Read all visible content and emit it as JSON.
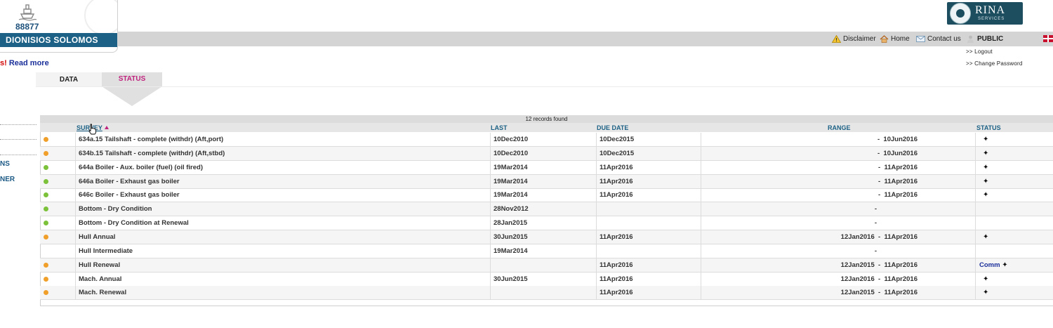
{
  "ship": {
    "number": "88877",
    "name": "DIONISIOS SOLOMOS"
  },
  "brand": {
    "name": "RINA",
    "sub": "SERVICES"
  },
  "nav": {
    "disclaimer": "Disclaimer",
    "home": "Home",
    "contact": "Contact us",
    "user": "PUBLIC"
  },
  "account": {
    "logout": ">> Logout",
    "change_password": ">> Change Password"
  },
  "alert": {
    "prefix": "s!",
    "link": "Read more"
  },
  "tabs": [
    {
      "label": "DATA"
    },
    {
      "label": "STATUS"
    }
  ],
  "sidebar": {
    "item1": "NS",
    "item2": "NER"
  },
  "table": {
    "records": "12 records found",
    "headers": {
      "survey": "SURVEY",
      "last": "LAST",
      "due": "DUE DATE",
      "range": "RANGE",
      "status": "STATUS"
    },
    "rows": [
      {
        "dot": "orange",
        "survey": "634a.15 Tailshaft - complete (withdr) (Aft,port)",
        "last": "10Dec2010",
        "due": "10Dec2015",
        "range": " -  10Jun2016",
        "status": "✦",
        "comm": ""
      },
      {
        "dot": "orange",
        "survey": "634b.15 Tailshaft - complete (withdr) (Aft,stbd)",
        "last": "10Dec2010",
        "due": "10Dec2015",
        "range": " -  10Jun2016",
        "status": "✦",
        "comm": ""
      },
      {
        "dot": "green",
        "survey": "644a Boiler - Aux. boiler (fuel) (oil fired)",
        "last": "19Mar2014",
        "due": "11Apr2016",
        "range": " -  11Apr2016",
        "status": "✦",
        "comm": ""
      },
      {
        "dot": "green",
        "survey": "646a Boiler - Exhaust gas boiler",
        "last": "19Mar2014",
        "due": "11Apr2016",
        "range": " -  11Apr2016",
        "status": "✦",
        "comm": ""
      },
      {
        "dot": "green",
        "survey": "646c Boiler - Exhaust gas boiler",
        "last": "19Mar2014",
        "due": "11Apr2016",
        "range": " -  11Apr2016",
        "status": "✦",
        "comm": ""
      },
      {
        "dot": "green",
        "survey": "Bottom - Dry Condition",
        "last": "28Nov2012",
        "due": "",
        "range": "-",
        "status": "",
        "comm": ""
      },
      {
        "dot": "green",
        "survey": "Bottom - Dry Condition at Renewal",
        "last": "28Jan2015",
        "due": "",
        "range": "-",
        "status": "",
        "comm": ""
      },
      {
        "dot": "orange",
        "survey": "Hull Annual",
        "last": "30Jun2015",
        "due": "11Apr2016",
        "range": "12Jan2016  -  11Apr2016",
        "status": "✦",
        "comm": ""
      },
      {
        "dot": "",
        "survey": "Hull Intermediate",
        "last": "19Mar2014",
        "due": "",
        "range": "-",
        "status": "",
        "comm": ""
      },
      {
        "dot": "orange",
        "survey": "Hull Renewal",
        "last": "",
        "due": "11Apr2016",
        "range": "12Jan2015  -  11Apr2016",
        "status": "✦",
        "comm": "Comm"
      },
      {
        "dot": "orange",
        "survey": "Mach. Annual",
        "last": "30Jun2015",
        "due": "11Apr2016",
        "range": "12Jan2016  -  11Apr2016",
        "status": "✦",
        "comm": ""
      },
      {
        "dot": "orange",
        "survey": "Mach. Renewal",
        "last": "",
        "due": "11Apr2016",
        "range": "12Jan2015  -  11Apr2016",
        "status": "✦",
        "comm": ""
      }
    ]
  },
  "colors": {
    "accent": "#1d6286",
    "status_tab": "#c0237e",
    "dot_orange": "#f0a02a",
    "dot_green": "#7cc13a"
  }
}
